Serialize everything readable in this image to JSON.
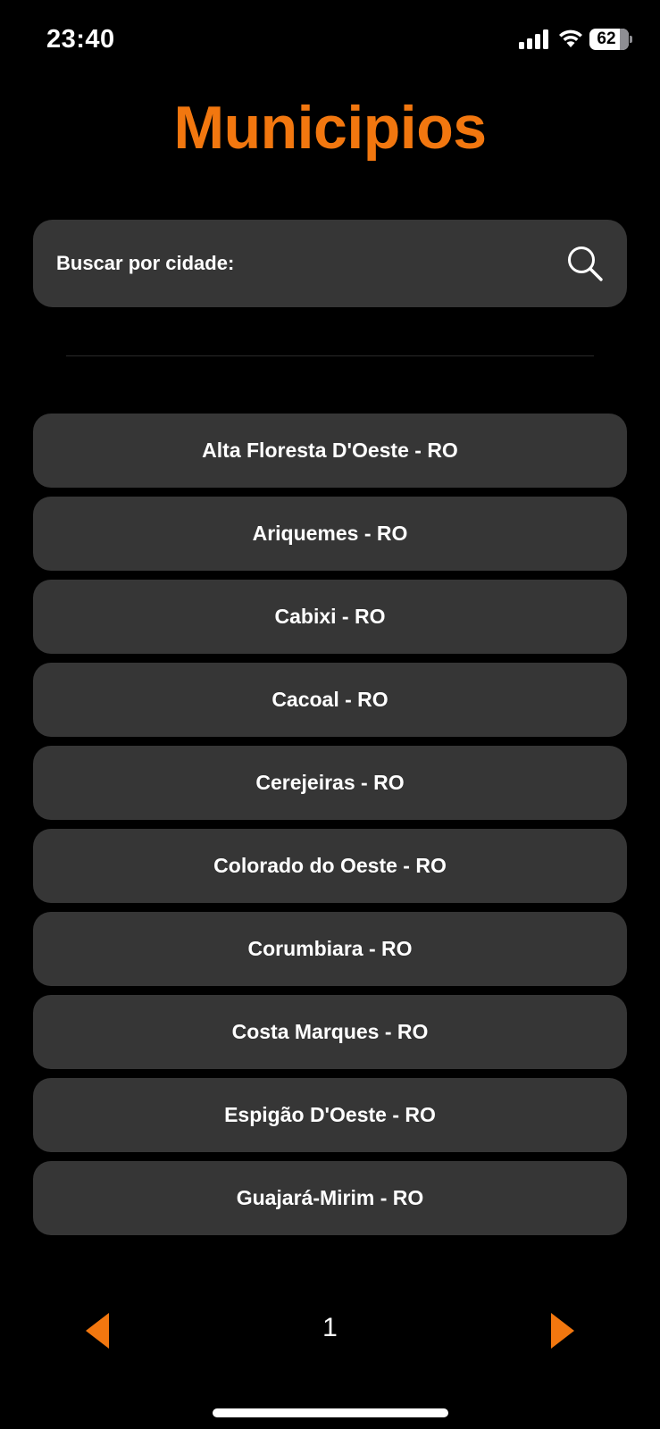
{
  "status_bar": {
    "time": "23:40",
    "battery": "62"
  },
  "header": {
    "title": "Municipios"
  },
  "search": {
    "label": "Buscar por cidade:",
    "icon": "search-icon"
  },
  "cities": [
    "Alta Floresta D'Oeste - RO",
    "Ariquemes - RO",
    "Cabixi - RO",
    "Cacoal - RO",
    "Cerejeiras - RO",
    "Colorado do Oeste - RO",
    "Corumbiara - RO",
    "Costa Marques - RO",
    "Espigão D'Oeste - RO",
    "Guajará-Mirim - RO"
  ],
  "pagination": {
    "current_page": "1",
    "prev_icon": "triangle-left-icon",
    "next_icon": "triangle-right-icon"
  },
  "colors": {
    "accent": "#f2770f",
    "card": "#363636",
    "background": "#000000"
  }
}
